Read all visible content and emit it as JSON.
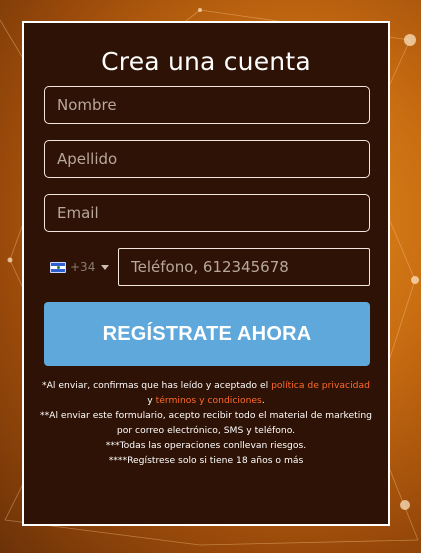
{
  "form": {
    "title": "Crea una cuenta",
    "first_name_placeholder": "Nombre",
    "last_name_placeholder": "Apellido",
    "email_placeholder": "Email",
    "phone": {
      "dial_code": "+34",
      "flag_icon": "flag-icon",
      "placeholder": "Teléfono, 612345678"
    },
    "submit_label": "REGÍSTRATE AHORA"
  },
  "legal": {
    "line1_prefix": "*Al enviar, confirmas que has leído y aceptado el ",
    "privacy_link": "política de privacidad",
    "line1_mid": " y ",
    "terms_link": "términos y condiciones",
    "line1_suffix": ".",
    "line2": "**Al enviar este formulario, acepto recibir todo el material de marketing por correo electrónico, SMS y teléfono.",
    "line3": "***Todas las operaciones conllevan riesgos.",
    "line4": "****Regístrese solo si tiene 18 años o más"
  },
  "colors": {
    "card_bg": "#2e1205",
    "button_bg": "#5fa8dc",
    "link": "#ff6a2a"
  }
}
